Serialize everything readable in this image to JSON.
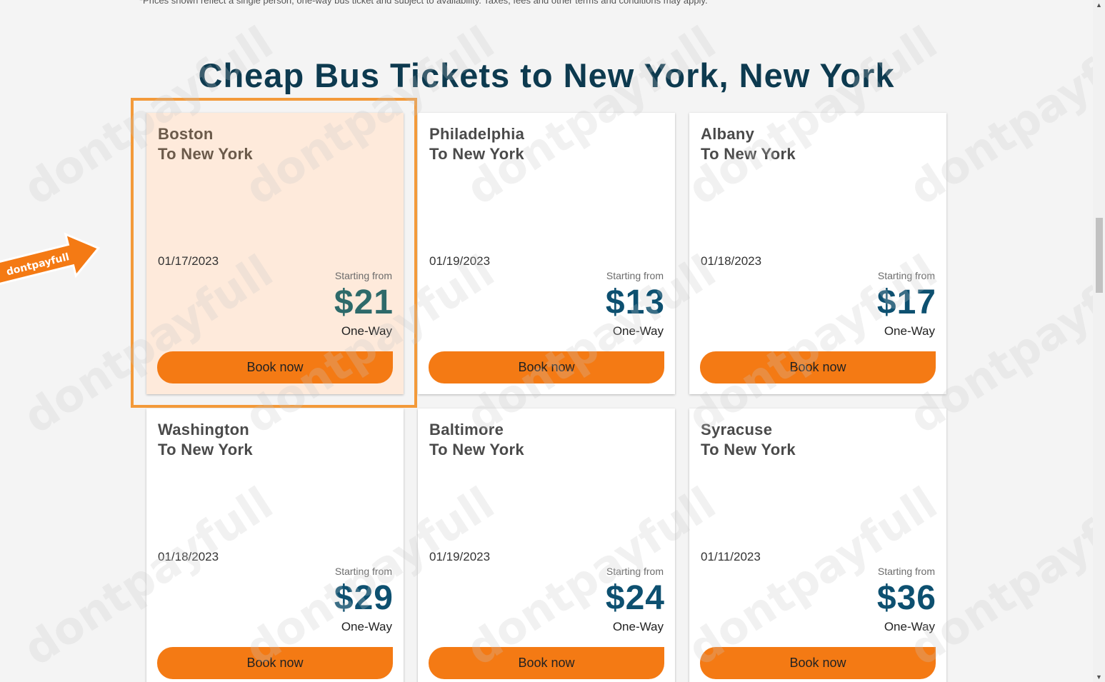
{
  "disclaimer": "*Prices shown reflect a single person, one-way bus ticket and subject to availability. Taxes, fees and other terms and conditions may apply.",
  "title": "Cheap Bus Tickets to New York, New York",
  "cards": [
    {
      "origin": "Boston",
      "dest": "To New York",
      "date": "01/17/2023",
      "starting": "Starting from",
      "price": "$21",
      "oneway": "One-Way",
      "button": "Book now"
    },
    {
      "origin": "Philadelphia",
      "dest": "To New York",
      "date": "01/19/2023",
      "starting": "Starting from",
      "price": "$13",
      "oneway": "One-Way",
      "button": "Book now"
    },
    {
      "origin": "Albany",
      "dest": "To New York",
      "date": "01/18/2023",
      "starting": "Starting from",
      "price": "$17",
      "oneway": "One-Way",
      "button": "Book now"
    },
    {
      "origin": "Washington",
      "dest": "To New York",
      "date": "01/18/2023",
      "starting": "Starting from",
      "price": "$29",
      "oneway": "One-Way",
      "button": "Book now"
    },
    {
      "origin": "Baltimore",
      "dest": "To New York",
      "date": "01/19/2023",
      "starting": "Starting from",
      "price": "$24",
      "oneway": "One-Way",
      "button": "Book now"
    },
    {
      "origin": "Syracuse",
      "dest": "To New York",
      "date": "01/11/2023",
      "starting": "Starting from",
      "price": "$36",
      "oneway": "One-Way",
      "button": "Book now"
    }
  ],
  "badge": {
    "text": "dontpayfull"
  },
  "watermark": "dontpayfull",
  "colors": {
    "title": "#0d3a4f",
    "price": "#0d5070",
    "button": "#f47a14",
    "highlight_frame": "#f39a3a",
    "highlight_card": "#feeadb"
  }
}
